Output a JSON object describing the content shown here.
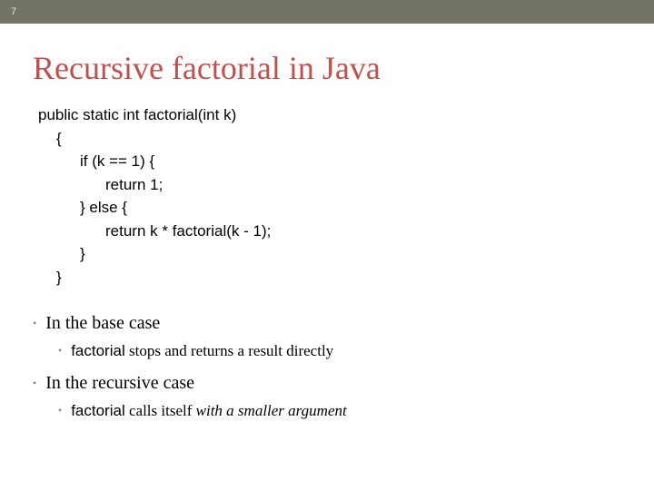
{
  "page_number": "7",
  "title": "Recursive factorial in Java",
  "code": {
    "l1": "public static int factorial(int k)",
    "l2": "{",
    "l3": "if (k == 1) {",
    "l4": "return 1;",
    "l5": "} else {",
    "l6": "return k * factorial(k - 1);",
    "l7": "}",
    "l8": "}"
  },
  "bullets": {
    "b1_text": "In the base case",
    "b1_sub_kw": "factorial",
    "b1_sub_rest": " stops and returns a result directly",
    "b2_text": "In the recursive case",
    "b2_sub_kw": "factorial",
    "b2_sub_mid": " calls itself ",
    "b2_sub_ital": "with a smaller argument"
  }
}
